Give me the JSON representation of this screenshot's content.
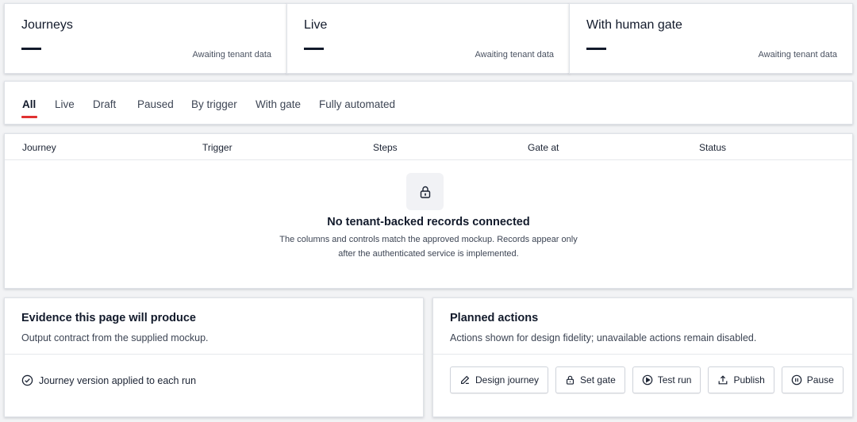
{
  "metrics": [
    {
      "title": "Journeys",
      "value": "—",
      "note": "Awaiting tenant data"
    },
    {
      "title": "Live",
      "value": "—",
      "note": "Awaiting tenant data"
    },
    {
      "title": "With human gate",
      "value": "—",
      "note": "Awaiting tenant data"
    }
  ],
  "tabs": [
    {
      "label": "All",
      "active": true
    },
    {
      "label": "Live"
    },
    {
      "label": "Draft"
    },
    {
      "label": "Paused"
    },
    {
      "label": "By trigger"
    },
    {
      "label": "With gate"
    },
    {
      "label": "Fully automated"
    }
  ],
  "table": {
    "columns": [
      "Journey",
      "Trigger",
      "Steps",
      "Gate at",
      "Status"
    ],
    "empty_icon": "lock-icon",
    "empty_title": "No tenant-backed records connected",
    "empty_line1": "The columns and controls match the approved mockup. Records appear only",
    "empty_line2": "after the authenticated service is implemented."
  },
  "evidence": {
    "title": "Evidence this page will produce",
    "subtitle": "Output contract from the supplied mockup.",
    "items": [
      {
        "label": "Journey version applied to each run",
        "icon": "check-circle-icon"
      }
    ]
  },
  "actions": {
    "title": "Planned actions",
    "subtitle": "Actions shown for design fidelity; unavailable actions remain disabled.",
    "buttons": [
      {
        "label": "Design journey",
        "icon": "pencil-icon"
      },
      {
        "label": "Set gate",
        "icon": "lock-icon"
      },
      {
        "label": "Test run",
        "icon": "play-circle-icon"
      },
      {
        "label": "Publish",
        "icon": "upload-icon"
      },
      {
        "label": "Pause",
        "icon": "pause-circle-icon"
      }
    ]
  },
  "colors": {
    "accent": "#e03131",
    "text": "#121a2b",
    "background": "#f2f3f5"
  }
}
